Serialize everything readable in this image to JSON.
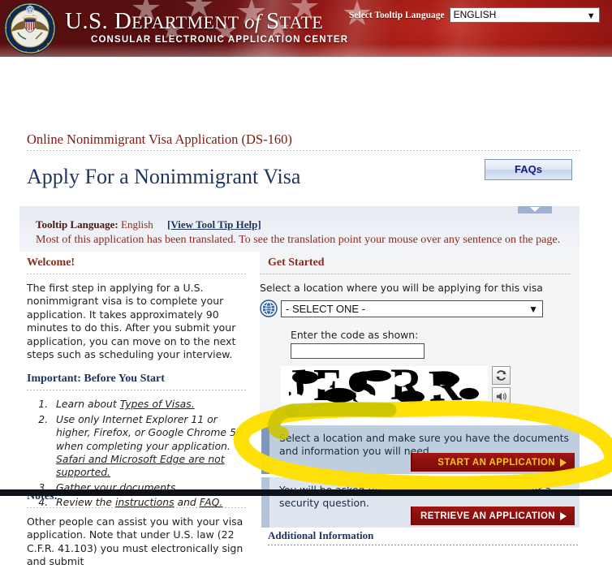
{
  "header": {
    "seal_icon": "great-seal-of-the-united-states",
    "department_title_1": "U.S. ",
    "department_title_2": "D",
    "department_title_3": "EPARTMENT",
    "department_title_of": " of ",
    "department_title_4": "S",
    "department_title_5": "TATE",
    "department_subtitle": "CONSULAR ELECTRONIC APPLICATION CENTER",
    "tooltip_language_label": "Select Tooltip Language",
    "tooltip_language_value": "ENGLISH",
    "chevron_icon": "chevron-down-icon"
  },
  "page": {
    "breadcrumb": "Online Nonimmigrant Visa Application (DS-160)",
    "title": "Apply For a Nonimmigrant Visa",
    "faqs_label": "FAQs"
  },
  "tooltip_panel": {
    "label": "Tooltip Language:",
    "language": "English",
    "help_link": "[View Tool Tip Help]",
    "message": "Most of this application has been translated. To see the translation point your mouse over any sentence on the page.",
    "collapse_icon": "triangle-down-icon"
  },
  "left_column": {
    "welcome_heading": "Welcome!",
    "welcome_body": "The first step in applying for a U.S. nonimmigrant visa is to complete your application. It takes approximately 90 minutes to do this. After you submit your application, you can move on to the next steps such as scheduling your interview.",
    "important_heading": "Important: Before You Start",
    "steps": [
      {
        "pre": "Learn about ",
        "link": "Types of Visas.",
        "post": ""
      },
      {
        "pre": "Use only Internet Explorer 11 or higher, Firefox, or Google Chrome 58 when completing your application. ",
        "link": "Safari and Microsoft Edge are not supported.",
        "post": ""
      },
      {
        "pre": "",
        "link": "Gather your documents.",
        "post": ""
      },
      {
        "pre": "Review the ",
        "link": "instructions",
        "mid": " and ",
        "link2": "FAQ.",
        "post": ""
      }
    ],
    "notes_heading": "Notes:",
    "notes_body": "Other people can assist you with your visa application. Note that under U.S. law (22 C.F.R. 41.103) you must electronically sign and submit"
  },
  "right_column": {
    "get_started_heading": "Get Started",
    "location_label": "Select a location where you will be applying for this visa",
    "globe_icon": "globe-icon",
    "location_value": "- SELECT ONE -",
    "chevron_icon": "chevron-down-icon",
    "code_label": "Enter the code as shown:",
    "code_value": "",
    "code_placeholder": "",
    "captcha_text": "JFSRR",
    "refresh_icon": "refresh-icon",
    "audio_icon": "audio-speaker-icon",
    "panels": [
      {
        "text": "Select a location and make sure you have the documents and information you will need.",
        "button_label": "START AN APPLICATION",
        "arrow_icon": "arrow-right-icon"
      },
      {
        "text": "You will be asked for your application ID and answer a security question.",
        "button_label": "RETRIEVE AN APPLICATION",
        "arrow_icon": "arrow-right-icon"
      }
    ],
    "additional_information_heading": "Additional Information"
  },
  "annotation": {
    "type": "yellow-highlighter-loop",
    "color": "#FFE000"
  },
  "colors": {
    "brand_red": "#8a2b20",
    "brand_navy": "#1f3560",
    "button_red": "#8d100d",
    "button_gold": "#f3c623",
    "panel_blue_dark": "#bfcede",
    "panel_blue_light": "#dde5ef",
    "highlighter_yellow": "#FFE000"
  }
}
